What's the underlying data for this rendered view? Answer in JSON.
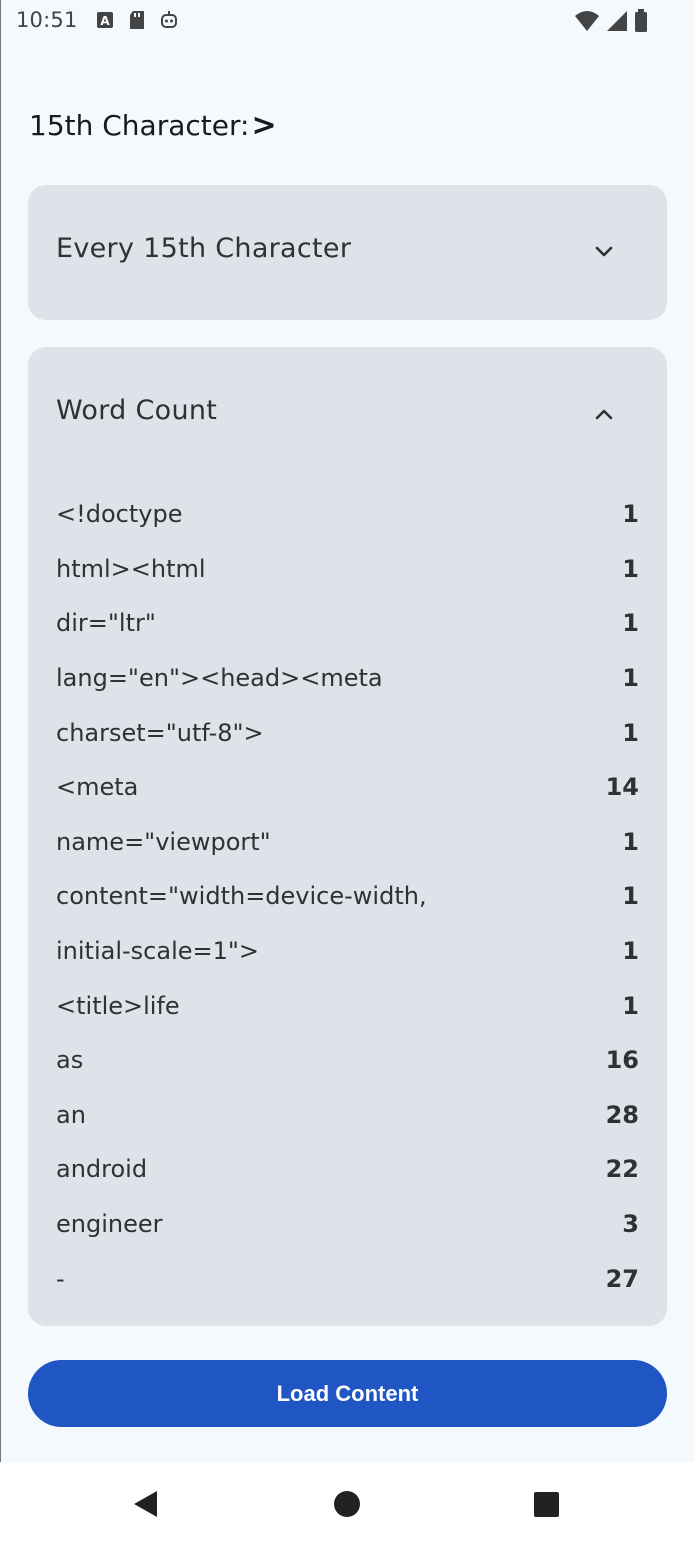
{
  "status_bar": {
    "time": "10:51",
    "left_icons": [
      "a-badge-icon",
      "sd-card-icon",
      "robot-face-icon"
    ],
    "right_icons": [
      "wifi-icon",
      "signal-icon",
      "battery-icon"
    ]
  },
  "character_display": {
    "label": "15th Character:",
    "value": ">"
  },
  "every_section": {
    "title": "Every 15th Character",
    "expanded": false,
    "icon": "chevron-down-icon"
  },
  "word_count_section": {
    "title": "Word Count",
    "expanded": true,
    "icon": "chevron-up-icon",
    "rows": [
      {
        "word": "<!doctype",
        "count": "1"
      },
      {
        "word": "html><html",
        "count": "1"
      },
      {
        "word": "dir=\"ltr\"",
        "count": "1"
      },
      {
        "word": "lang=\"en\"><head><meta",
        "count": "1"
      },
      {
        "word": "charset=\"utf-8\">",
        "count": "1"
      },
      {
        "word": "<meta",
        "count": "14"
      },
      {
        "word": "name=\"viewport\"",
        "count": "1"
      },
      {
        "word": "content=\"width=device-width,",
        "count": "1"
      },
      {
        "word": "initial-scale=1\">",
        "count": "1"
      },
      {
        "word": "<title>life",
        "count": "1"
      },
      {
        "word": "as",
        "count": "16"
      },
      {
        "word": "an",
        "count": "28"
      },
      {
        "word": "android",
        "count": "22"
      },
      {
        "word": "engineer",
        "count": "3"
      },
      {
        "word": "-",
        "count": "27"
      }
    ]
  },
  "load_button": {
    "label": "Load Content",
    "color": "#1f56c4"
  },
  "nav_bar": {
    "icons": [
      "back-icon",
      "home-icon",
      "recents-icon"
    ]
  }
}
